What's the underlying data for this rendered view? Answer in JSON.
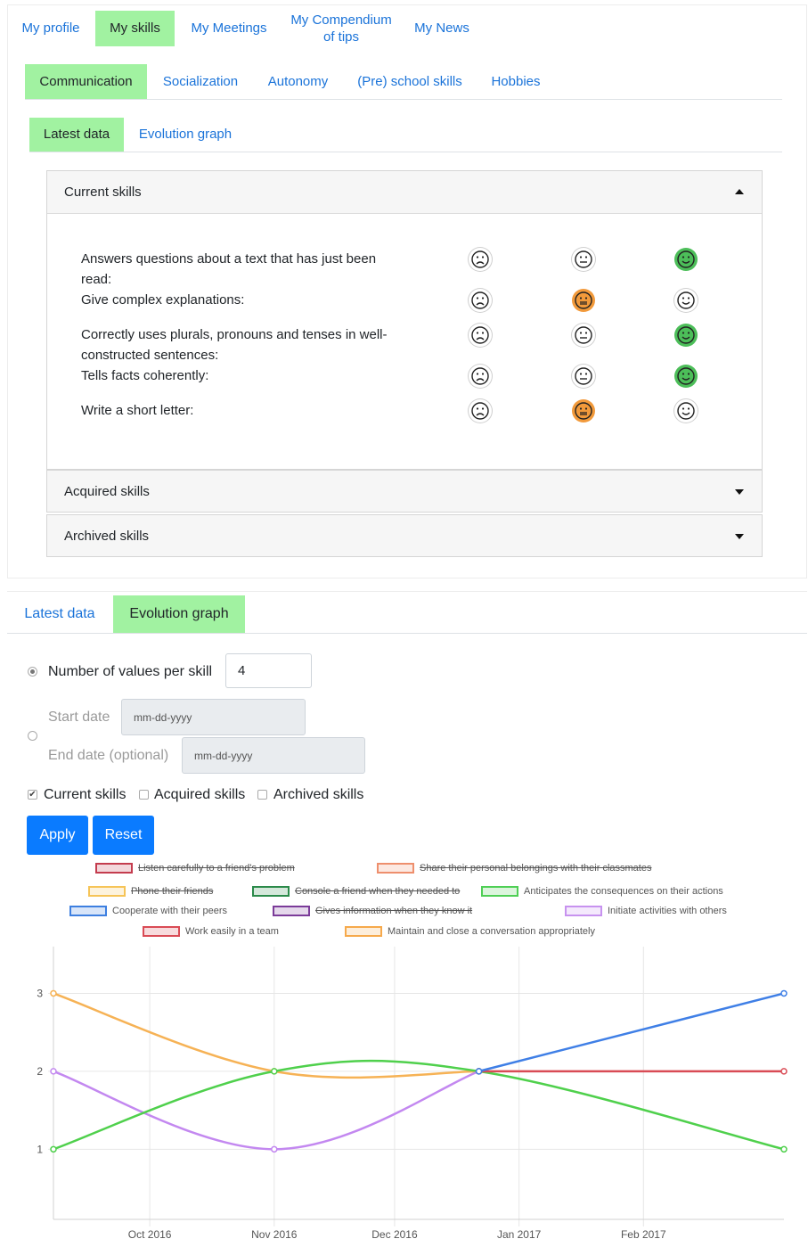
{
  "top_nav": [
    "My profile",
    "My skills",
    "My Meetings",
    "My Compendium of tips",
    "My News"
  ],
  "category_tabs": [
    "Communication",
    "Socialization",
    "Autonomy",
    "(Pre) school skills",
    "Hobbies"
  ],
  "view_tabs": [
    "Latest data",
    "Evolution graph"
  ],
  "accordion": {
    "current": "Current skills",
    "acquired": "Acquired skills",
    "archived": "Archived skills"
  },
  "skills": [
    {
      "label": "Answers questions about a text that has just been read:",
      "rating": "happy"
    },
    {
      "label": "Give complex explanations:",
      "rating": "neutral"
    },
    {
      "label": "Correctly uses plurals, pronouns and tenses in well-constructed sentences:",
      "rating": "happy"
    },
    {
      "label": "Tells facts coherently:",
      "rating": "happy"
    },
    {
      "label": "Write a short letter:",
      "rating": "neutral"
    }
  ],
  "colors": {
    "tab_active": "#a1f2a1",
    "link": "#1a73d9",
    "neutral_selected": "#f29a3b",
    "happy_selected": "#4cbe59",
    "button": "#0a7bff"
  },
  "evolution": {
    "tabs": [
      "Latest data",
      "Evolution graph"
    ],
    "num_values_label": "Number of values per skill",
    "num_values": "4",
    "start_date_label": "Start date",
    "end_date_label": "End date (optional)",
    "date_placeholder": "mm-dd-yyyy",
    "mode": "number_of_values",
    "checkboxes": [
      {
        "label": "Current skills",
        "checked": true
      },
      {
        "label": "Acquired skills",
        "checked": false
      },
      {
        "label": "Archived skills",
        "checked": false
      }
    ],
    "apply": "Apply",
    "reset": "Reset"
  },
  "chart_data": {
    "type": "line",
    "title": "",
    "xlabel": "",
    "ylabel": "",
    "x_ticks": [
      "Oct 2016",
      "Nov 2016",
      "Dec 2016",
      "Jan 2017",
      "Feb 2017"
    ],
    "y_ticks": [
      1,
      2,
      3
    ],
    "x_range": [
      "2016-09-07",
      "2017-03-08"
    ],
    "ylim": [
      0.1,
      3.6
    ],
    "grid": true,
    "legend_position": "top",
    "legend": [
      {
        "name": "Listen carefully to a friend's problem",
        "color": "#c43c4e",
        "hidden": true
      },
      {
        "name": "Share their personal belongings with their classmates",
        "color": "#ee8f6d",
        "hidden": true
      },
      {
        "name": "Phone their friends",
        "color": "#f6c457",
        "hidden": true
      },
      {
        "name": "Console a friend when they needed to",
        "color": "#2b8a4a",
        "hidden": true
      },
      {
        "name": "Anticipates the consequences on their actions",
        "color": "#4fcf55",
        "hidden": false
      },
      {
        "name": "Cooperate with their peers",
        "color": "#3d7fe0",
        "hidden": false
      },
      {
        "name": "Gives information when they know it",
        "color": "#7b3b99",
        "hidden": true
      },
      {
        "name": "Initiate activities with others",
        "color": "#c792ef",
        "hidden": false
      },
      {
        "name": "Work easily in a team",
        "color": "#d94b55",
        "hidden": false
      },
      {
        "name": "Maintain and close a conversation appropriately",
        "color": "#f6a94b",
        "hidden": false
      }
    ],
    "series": [
      {
        "name": "Maintain and close a conversation appropriately",
        "color": "#f6b255",
        "points": [
          [
            "2016-09-07",
            3
          ],
          [
            "2016-11-01",
            2
          ],
          [
            "2016-12-22",
            2
          ]
        ]
      },
      {
        "name": "Initiate activities with others",
        "color": "#c388f0",
        "points": [
          [
            "2016-09-07",
            2
          ],
          [
            "2016-11-01",
            1
          ],
          [
            "2016-12-22",
            2
          ]
        ]
      },
      {
        "name": "Anticipates the consequences on their actions",
        "color": "#4fd04c",
        "points": [
          [
            "2016-09-07",
            1
          ],
          [
            "2016-11-01",
            2
          ],
          [
            "2016-12-22",
            2
          ],
          [
            "2017-03-08",
            1
          ]
        ]
      },
      {
        "name": "Work easily in a team",
        "color": "#d94b55",
        "points": [
          [
            "2016-12-22",
            2
          ],
          [
            "2017-03-08",
            2
          ]
        ]
      },
      {
        "name": "Cooperate with their peers",
        "color": "#3f7fe6",
        "points": [
          [
            "2016-12-22",
            2
          ],
          [
            "2017-03-08",
            3
          ]
        ]
      }
    ]
  }
}
